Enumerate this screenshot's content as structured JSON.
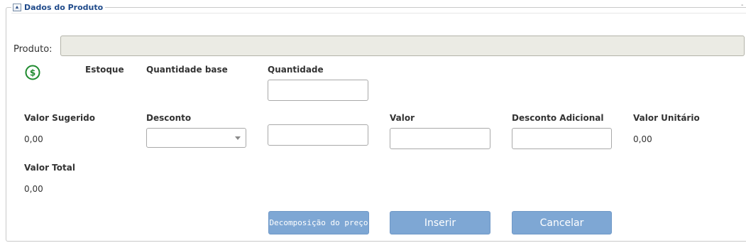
{
  "section": {
    "title": "Dados do Produto",
    "toggle_icon": "▲"
  },
  "produto": {
    "label": "Produto:",
    "value": ""
  },
  "estoque": {
    "label": "Estoque"
  },
  "quantidade_base": {
    "label": "Quantidade base"
  },
  "quantidade": {
    "label": "Quantidade",
    "value": ""
  },
  "valor_sugerido": {
    "label": "Valor Sugerido",
    "value": "0,00"
  },
  "desconto": {
    "label": "Desconto",
    "selected": ""
  },
  "desconto_valor": {
    "value": ""
  },
  "valor": {
    "label": "Valor",
    "value": ""
  },
  "desconto_adicional": {
    "label": "Desconto Adicional",
    "value": ""
  },
  "valor_unitario": {
    "label": "Valor Unitário",
    "value": "0,00"
  },
  "valor_total": {
    "label": "Valor Total",
    "value": "0,00"
  },
  "buttons": {
    "decomposicao": "Decomposição do preço",
    "inserir": "Inserir",
    "cancelar": "Cancelar"
  },
  "colors": {
    "accent": "#1f4a8a",
    "button": "#7ea7d4",
    "dollar_icon": "#1e8a2e"
  },
  "icons": {
    "price": "dollar-circle-icon"
  }
}
